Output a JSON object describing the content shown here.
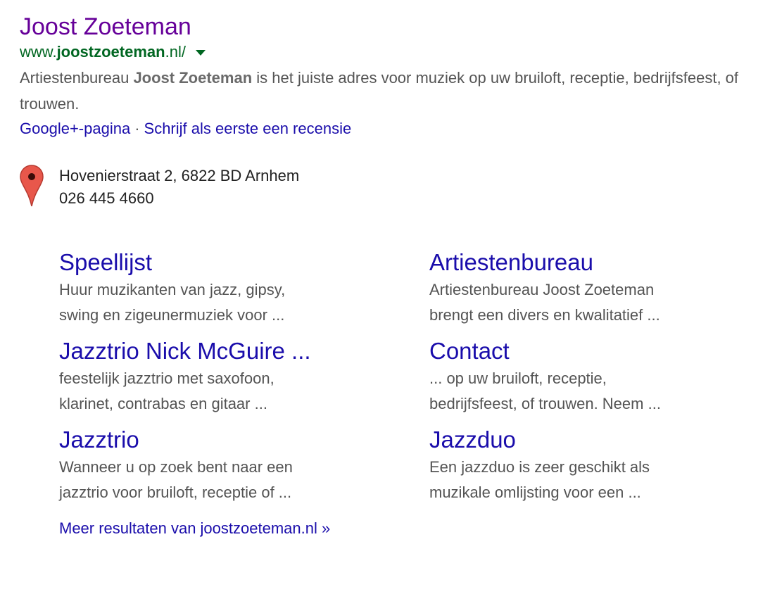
{
  "result": {
    "title": "Joost Zoeteman",
    "url_prefix": "www.",
    "url_bold": "joostzoeteman",
    "url_suffix": ".nl/",
    "snippet_pre": "Artiestenbureau ",
    "snippet_bold": "Joost Zoeteman",
    "snippet_post": " is het juiste adres voor muziek op uw bruiloft, receptie, bedrijfsfeest, of trouwen.",
    "link_google_plus": "Google+-pagina",
    "link_separator": "·",
    "link_review": "Schrijf als eerste een recensie"
  },
  "local": {
    "pin_icon": "map-pin-icon",
    "address": "Hovenierstraat 2, 6822 BD Arnhem",
    "phone": "026 445 4660"
  },
  "sitelinks": [
    {
      "title": "Speellijst",
      "desc1": "Huur muzikanten van jazz, gipsy,",
      "desc2": "swing en zigeunermuziek voor ..."
    },
    {
      "title": "Artiestenbureau",
      "desc1": "Artiestenbureau Joost Zoeteman",
      "desc2": "brengt een divers en kwalitatief ..."
    },
    {
      "title": "Jazztrio Nick McGuire ...",
      "desc1": "feestelijk jazztrio met saxofoon,",
      "desc2": "klarinet, contrabas en gitaar ..."
    },
    {
      "title": "Contact",
      "desc1": "... op uw bruiloft, receptie,",
      "desc2": "bedrijfsfeest, of trouwen. Neem ..."
    },
    {
      "title": "Jazztrio",
      "desc1": "Wanneer u op zoek bent naar een",
      "desc2": "jazztrio voor bruiloft, receptie of ..."
    },
    {
      "title": "Jazzduo",
      "desc1": "Een jazzduo is zeer geschikt als",
      "desc2": "muzikale omlijsting voor een ..."
    }
  ],
  "more_results": "Meer resultaten van joostzoeteman.nl »",
  "colors": {
    "visited_title": "#660099",
    "url_green": "#006621",
    "link_blue": "#1a0dab",
    "snippet_gray": "#545454",
    "pin_red": "#e8574b"
  }
}
